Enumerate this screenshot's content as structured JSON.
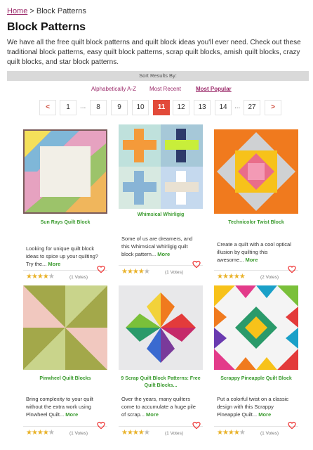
{
  "breadcrumb": {
    "home": "Home",
    "separator": ">",
    "current": "Block Patterns"
  },
  "title": "Block Patterns",
  "intro": "We have all the free quilt block patterns and quilt block ideas you'll ever need. Check out these traditional block patterns, easy quilt block patterns, scrap quilt blocks, amish quilt blocks, crazy quilt blocks, and star block patterns.",
  "sort": {
    "label": "Sort Results By:",
    "options": [
      "Alphabetically A-Z",
      "Most Recent",
      "Most Popular"
    ],
    "active": "Most Popular"
  },
  "pagination": {
    "prev": "<",
    "next": ">",
    "ellipsis": "...",
    "pages": [
      "1",
      "8",
      "9",
      "10",
      "11",
      "12",
      "13",
      "14",
      "27"
    ],
    "current": "11"
  },
  "cards": [
    {
      "title": "Sun Rays Quilt Block",
      "desc": "Looking for unique quilt block ideas to spice up your quilting? Try the...",
      "more": "More",
      "rating": 4,
      "votes": "(1 Votes)",
      "image_icon": "quilt-block-image"
    },
    {
      "title": "Whimsical Whirligig",
      "desc": "Some of us are dreamers, and this Whimsical Whirligig quilt block pattern...",
      "more": "More",
      "rating": 4,
      "votes": "(1 Votes)",
      "image_icon": "quilt-block-image"
    },
    {
      "title": "Technicolor Twist Block",
      "desc": "Create a quilt with a cool optical illusion by quilting this awesome...",
      "more": "More",
      "rating": 5,
      "votes": "(2 Votes)",
      "image_icon": "quilt-block-image"
    },
    {
      "title": "Pinwheel Quilt Blocks",
      "desc": "Bring complexity to your quilt without the extra work using Pinwheel Quilt...",
      "more": "More",
      "rating": 4,
      "votes": "(1 Votes)",
      "image_icon": "quilt-block-image"
    },
    {
      "title": "9 Scrap Quilt Block Patterns: Free Quilt Blocks...",
      "desc": "Over the years, many quilters come to accumulate a huge pile of scrap...",
      "more": "More",
      "rating": 4,
      "votes": "(1 Votes)",
      "image_icon": "quilt-block-image"
    },
    {
      "title": "Scrappy Pineapple Quilt Block",
      "desc": "Put a colorful twist on a classic design with this Scrappy Pineapple Quilt...",
      "more": "More",
      "rating": 4,
      "votes": "(1 Votes)",
      "image_icon": "quilt-block-image"
    }
  ],
  "colors": {
    "link": "#9b2a6a",
    "accent": "#e24a3a",
    "card_title": "#3a9a2e",
    "star": "#e9b22a",
    "heart": "#e33"
  },
  "icons": {
    "favorite": "heart-icon",
    "rating": "star-icon"
  }
}
